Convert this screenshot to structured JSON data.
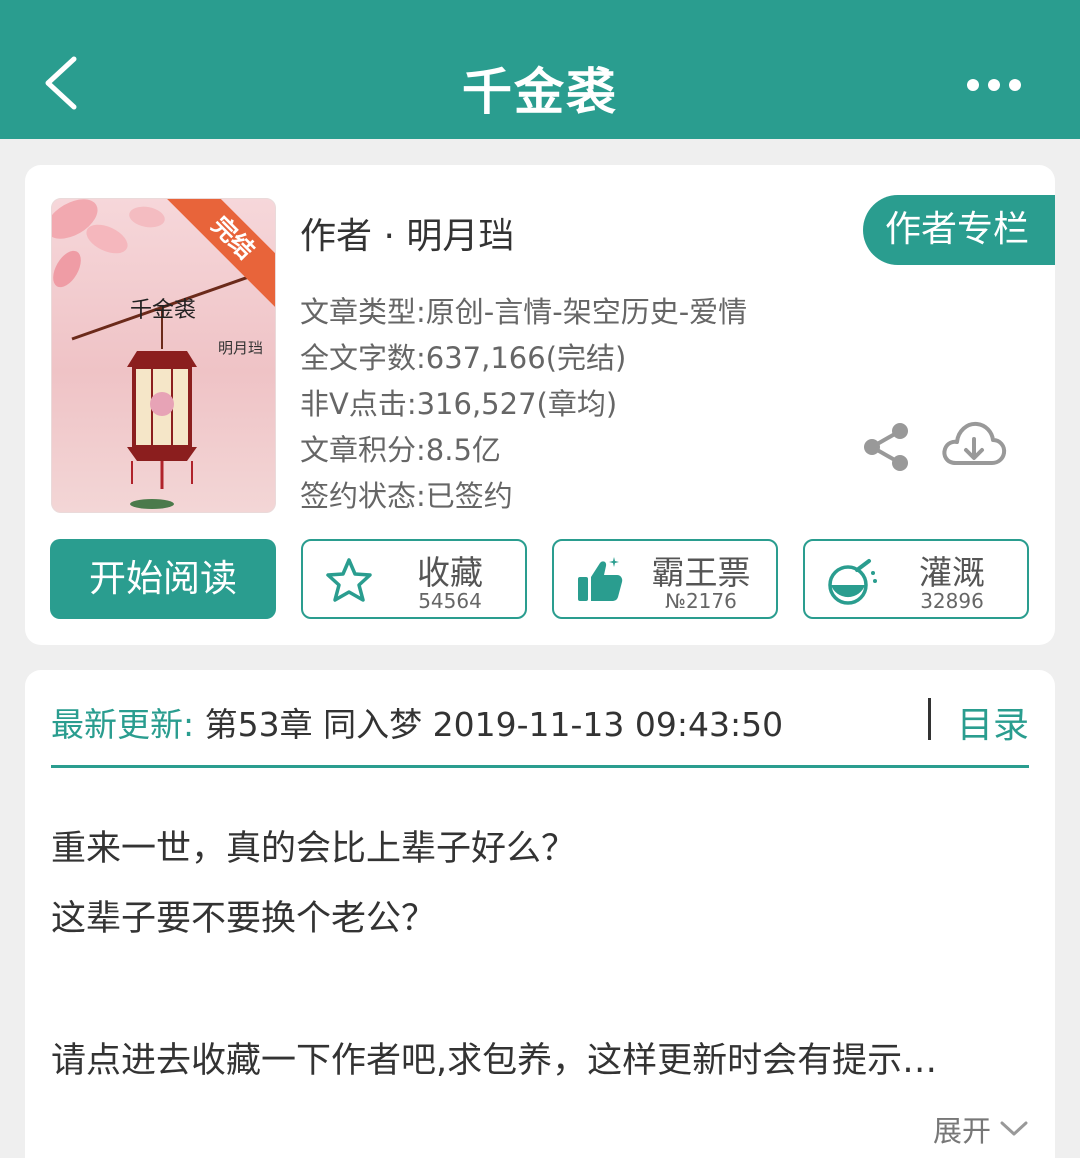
{
  "header": {
    "title": "千金裘",
    "back_icon": "chevron-left-icon",
    "more_icon": "more-horizontal-icon"
  },
  "book": {
    "cover": {
      "title": "千金裘",
      "author": "明月珰",
      "badge": "完结"
    },
    "author_line": "作者 · 明月珰",
    "author_column_button": "作者专栏",
    "meta": [
      "文章类型:原创-言情-架空历史-爱情",
      "全文字数:637,166(完结)",
      "非V点击:316,527(章均)",
      "文章积分:8.5亿",
      "签约状态:已签约"
    ]
  },
  "actions": {
    "start_reading": "开始阅读",
    "favorite": {
      "label": "收藏",
      "count": "54564",
      "icon": "star-icon"
    },
    "vote": {
      "label": "霸王票",
      "count": "№2176",
      "icon": "thumbs-up-icon"
    },
    "water": {
      "label": "灌溉",
      "count": "32896",
      "icon": "watering-flask-icon"
    }
  },
  "latest": {
    "label": "最新更新:",
    "text": " 第53章 同入梦 2019-11-13 09:43:50",
    "toc": "目录"
  },
  "description": {
    "lines": [
      "重来一世，真的会比上辈子好么？",
      "这辈子要不要换个老公？",
      "请点进去收藏一下作者吧,求包养，这样更新时会有提示…"
    ],
    "expand": "展开"
  },
  "colors": {
    "accent": "#2a9d8f",
    "badge": "#e8643a"
  }
}
